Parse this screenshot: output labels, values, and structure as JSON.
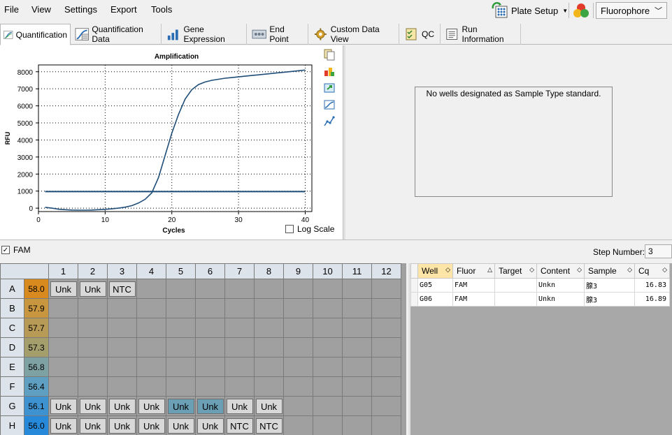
{
  "menu": {
    "file": "File",
    "view": "View",
    "settings": "Settings",
    "export": "Export",
    "tools": "Tools",
    "plate_setup": "Plate Setup",
    "fluorophore_select": "Fluorophore"
  },
  "tabs": [
    {
      "label": "Quantification",
      "active": true
    },
    {
      "label": "Quantification Data"
    },
    {
      "label": "Gene Expression"
    },
    {
      "label": "End Point"
    },
    {
      "label": "Custom Data View"
    },
    {
      "label": "QC"
    },
    {
      "label": "Run Information"
    }
  ],
  "chart_data": {
    "type": "line",
    "title": "Amplification",
    "xlabel": "Cycles",
    "ylabel": "RFU",
    "xlim": [
      0,
      41
    ],
    "ylim": [
      -200,
      8400
    ],
    "xticks": [
      0,
      10,
      20,
      30,
      40
    ],
    "yticks": [
      0,
      1000,
      2000,
      3000,
      4000,
      5000,
      6000,
      7000,
      8000
    ],
    "grid": true,
    "series": [
      {
        "color": "#1f4e79",
        "x": [
          1,
          2,
          3,
          4,
          5,
          6,
          7,
          8,
          9,
          10,
          11,
          12,
          13,
          14,
          15,
          16,
          17,
          18,
          19,
          20,
          21,
          22,
          23,
          24,
          25,
          26,
          27,
          28,
          29,
          30,
          31,
          32,
          33,
          34,
          35,
          36,
          37,
          38,
          39,
          40
        ],
        "y": [
          50,
          0,
          -60,
          -90,
          -110,
          -120,
          -120,
          -110,
          -90,
          -70,
          -40,
          0,
          60,
          150,
          300,
          520,
          900,
          1800,
          3100,
          4400,
          5500,
          6400,
          6950,
          7250,
          7400,
          7500,
          7560,
          7620,
          7660,
          7700,
          7740,
          7780,
          7820,
          7860,
          7900,
          7940,
          7980,
          8020,
          8060,
          8100
        ]
      },
      {
        "name": "threshold",
        "color": "#1f4e79",
        "x": [
          1,
          40
        ],
        "y": [
          970,
          970
        ]
      }
    ]
  },
  "chart": {
    "log_scale_label": "Log Scale",
    "log_scale_checked": false
  },
  "standard_curve": {
    "message": "No wells designated as Sample Type standard."
  },
  "fluor_filter": {
    "label": "FAM",
    "checked": true,
    "step_label": "Step Number:",
    "step_value": "3"
  },
  "plate": {
    "columns": [
      "1",
      "2",
      "3",
      "4",
      "5",
      "6",
      "7",
      "8",
      "9",
      "10",
      "11",
      "12"
    ],
    "rows": [
      {
        "label": "A",
        "temp": "58.0",
        "temp_color": "#d98a1f",
        "wells": [
          "Unk",
          "Unk",
          "NTC",
          "",
          "",
          "",
          "",
          "",
          "",
          "",
          "",
          ""
        ],
        "selected": []
      },
      {
        "label": "B",
        "temp": "57.9",
        "temp_color": "#c99640",
        "wells": [
          "",
          "",
          "",
          "",
          "",
          "",
          "",
          "",
          "",
          "",
          "",
          ""
        ],
        "selected": []
      },
      {
        "label": "C",
        "temp": "57.7",
        "temp_color": "#b69a55",
        "wells": [
          "",
          "",
          "",
          "",
          "",
          "",
          "",
          "",
          "",
          "",
          "",
          ""
        ],
        "selected": []
      },
      {
        "label": "D",
        "temp": "57.3",
        "temp_color": "#a39e6c",
        "wells": [
          "",
          "",
          "",
          "",
          "",
          "",
          "",
          "",
          "",
          "",
          "",
          ""
        ],
        "selected": []
      },
      {
        "label": "E",
        "temp": "56.8",
        "temp_color": "#7ea1a4",
        "wells": [
          "",
          "",
          "",
          "",
          "",
          "",
          "",
          "",
          "",
          "",
          "",
          ""
        ],
        "selected": []
      },
      {
        "label": "F",
        "temp": "56.4",
        "temp_color": "#5f9fc2",
        "wells": [
          "",
          "",
          "",
          "",
          "",
          "",
          "",
          "",
          "",
          "",
          "",
          ""
        ],
        "selected": []
      },
      {
        "label": "G",
        "temp": "56.1",
        "temp_color": "#3e92cf",
        "wells": [
          "Unk",
          "Unk",
          "Unk",
          "Unk",
          "Unk",
          "Unk",
          "Unk",
          "Unk",
          "",
          "",
          "",
          ""
        ],
        "selected": [
          4,
          5
        ]
      },
      {
        "label": "H",
        "temp": "56.0",
        "temp_color": "#2789da",
        "wells": [
          "Unk",
          "Unk",
          "Unk",
          "Unk",
          "Unk",
          "Unk",
          "NTC",
          "NTC",
          "",
          "",
          "",
          ""
        ],
        "selected": []
      }
    ]
  },
  "results": {
    "headers": [
      "Well",
      "Fluor",
      "Target",
      "Content",
      "Sample",
      "Cq"
    ],
    "rows": [
      [
        "G05",
        "FAM",
        "",
        "Unkn",
        "腺3",
        "16.83"
      ],
      [
        "G06",
        "FAM",
        "",
        "Unkn",
        "腺3",
        "16.89"
      ]
    ]
  },
  "colors": {
    "curve": "#1f4e79",
    "selected_well": "#6a9fb5",
    "well": "#d8d8d8",
    "plate_bg": "#a0a0a0",
    "header_bg": "#dde3ea",
    "sorted_header": "#fde5a8"
  }
}
